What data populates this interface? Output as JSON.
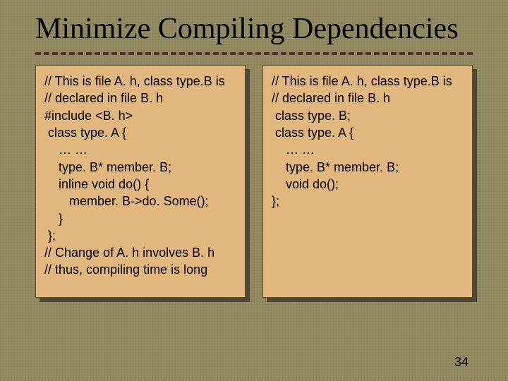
{
  "title": "Minimize Compiling Dependencies",
  "left": {
    "lines": [
      "// This is file A. h, class type.B is",
      "// declared in file B. h",
      "#include <B. h>",
      " class type. A {",
      "    … …",
      "    type. B* member. B;",
      "    inline void do() {",
      "       member. B->do. Some();",
      "    }",
      " };",
      "// Change of A. h involves B. h",
      "// thus, compiling time is long"
    ]
  },
  "right": {
    "lines": [
      "// This is file A. h, class type.B is",
      "// declared in file B. h",
      "",
      " class type. B;",
      " class type. A {",
      "    … …",
      "    type. B* member. B;",
      "    void do();",
      "};"
    ]
  },
  "slide_number": "34"
}
